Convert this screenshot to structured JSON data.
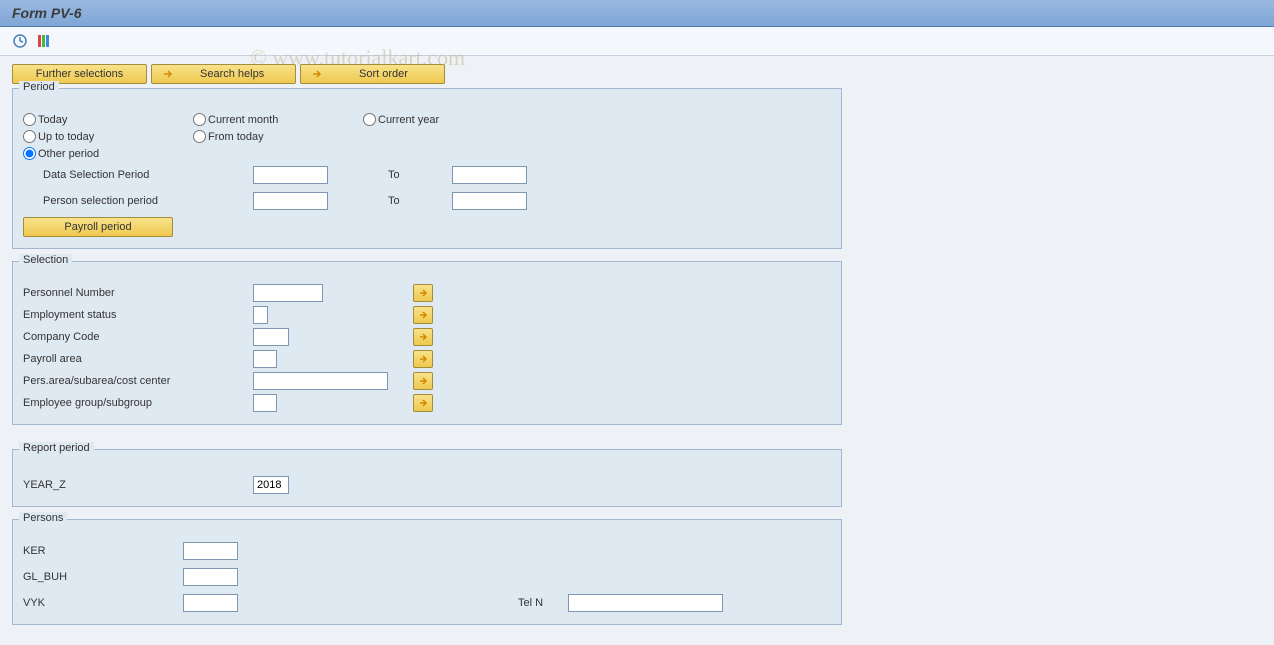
{
  "title": "Form PV-6",
  "watermark": "© www.tutorialkart.com",
  "buttons": {
    "further_selections": "Further selections",
    "search_helps": "Search helps",
    "sort_order": "Sort order",
    "payroll_period": "Payroll period"
  },
  "period": {
    "legend": "Period",
    "today": "Today",
    "current_month": "Current month",
    "current_year": "Current year",
    "up_to_today": "Up to today",
    "from_today": "From today",
    "other_period": "Other period",
    "data_selection_period": "Data Selection Period",
    "person_selection_period": "Person selection period",
    "to": "To"
  },
  "selection": {
    "legend": "Selection",
    "personnel_number": "Personnel Number",
    "employment_status": "Employment status",
    "company_code": "Company Code",
    "payroll_area": "Payroll area",
    "pers_area": "Pers.area/subarea/cost center",
    "employee_group": "Employee group/subgroup"
  },
  "report_period": {
    "legend": "Report period",
    "year_z": "YEAR_Z",
    "year_value": "2018"
  },
  "persons": {
    "legend": "Persons",
    "ker": "KER",
    "gl_buh": "GL_BUH",
    "vyk": "VYK",
    "tel_n": "Tel N"
  }
}
